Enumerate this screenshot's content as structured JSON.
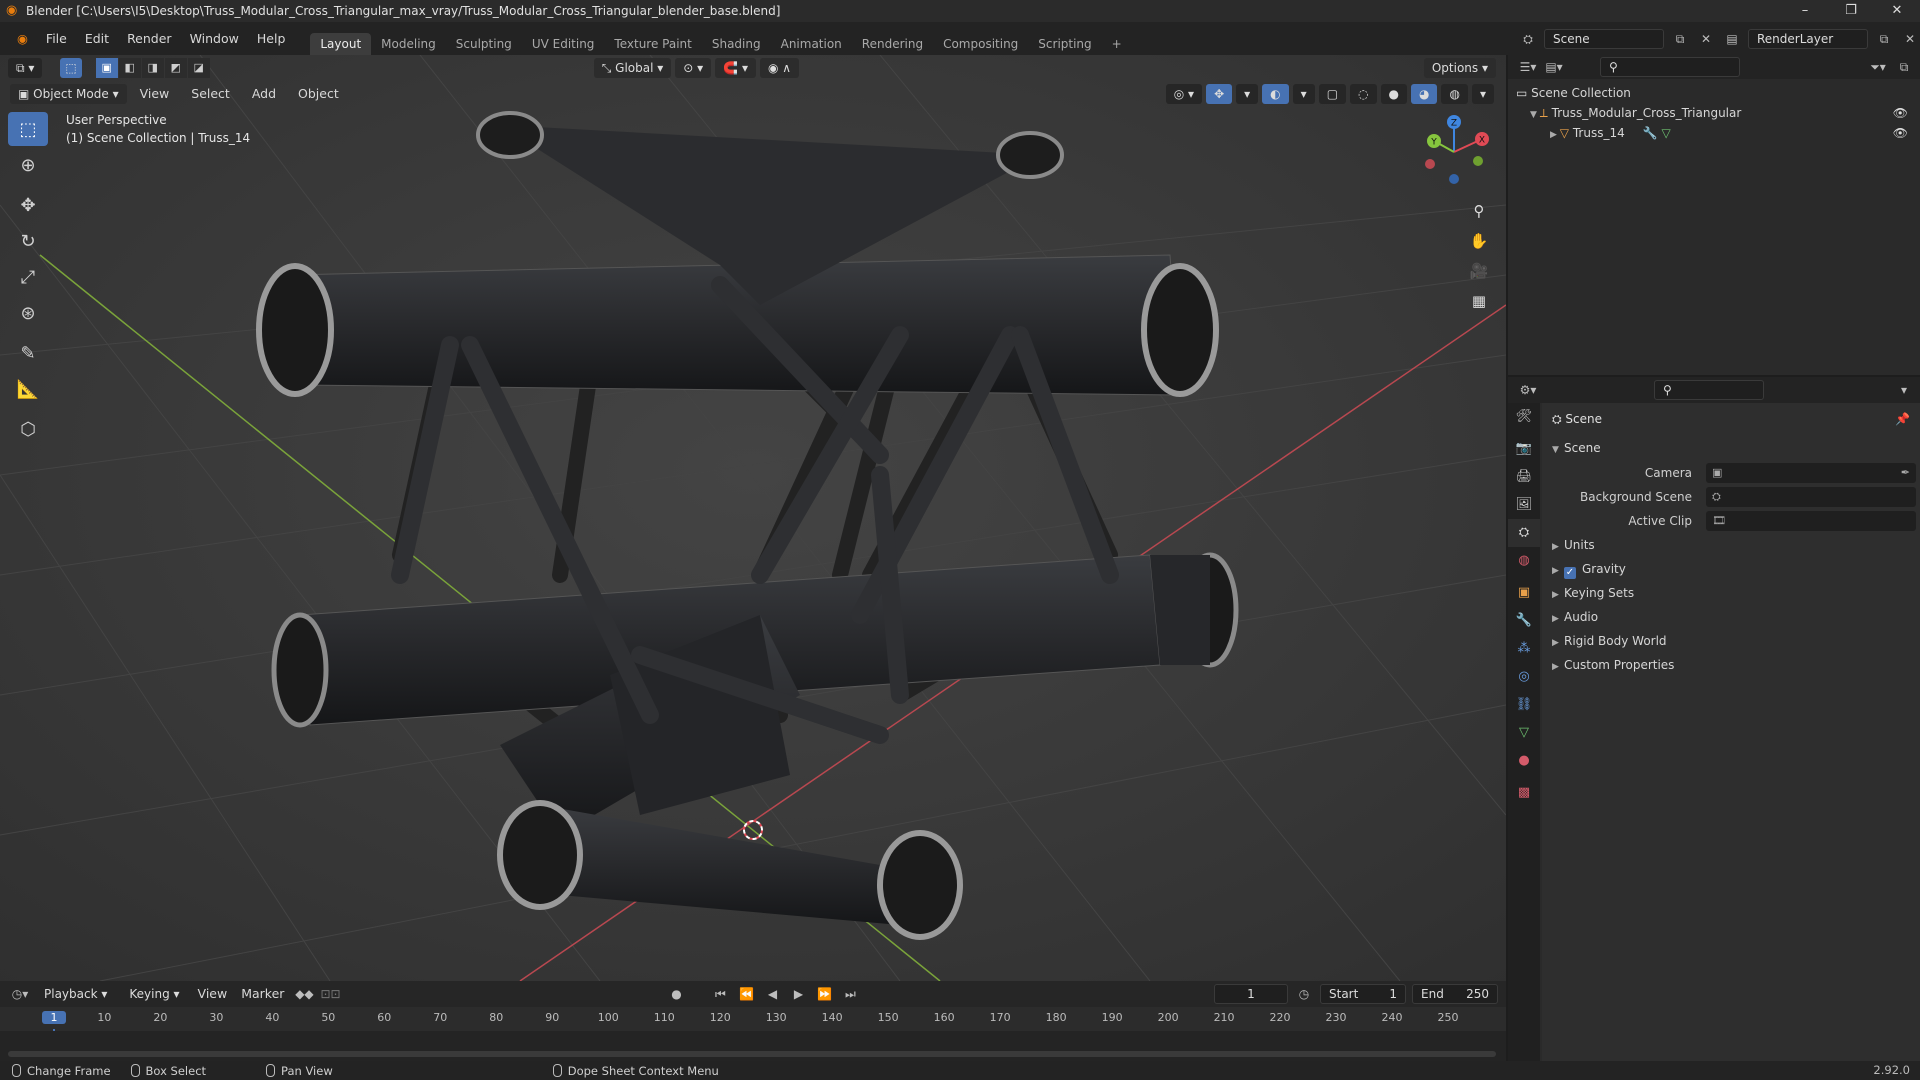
{
  "window": {
    "title": "Blender [C:\\Users\\I5\\Desktop\\Truss_Modular_Cross_Triangular_max_vray/Truss_Modular_Cross_Triangular_blender_base.blend]",
    "controls": [
      "–",
      "❐",
      "✕"
    ]
  },
  "menu": [
    "File",
    "Edit",
    "Render",
    "Window",
    "Help"
  ],
  "workspaces": [
    "Layout",
    "Modeling",
    "Sculpting",
    "UV Editing",
    "Texture Paint",
    "Shading",
    "Animation",
    "Rendering",
    "Compositing",
    "Scripting",
    "+"
  ],
  "active_workspace": "Layout",
  "scene_selector": {
    "scene": "Scene",
    "view_layer": "RenderLayer"
  },
  "viewport": {
    "mode": "Object Mode",
    "menus": [
      "View",
      "Select",
      "Add",
      "Object"
    ],
    "transform_orientation": "Global",
    "options_label": "Options",
    "overlay_line1": "User Perspective",
    "overlay_line2": "(1) Scene Collection | Truss_14",
    "gizmo_axes": {
      "x": "X",
      "y": "Y",
      "z": "Z"
    }
  },
  "tools": [
    "select-box",
    "cursor",
    "move",
    "rotate",
    "scale",
    "transform",
    "annotate",
    "measure",
    "add-cube"
  ],
  "outliner": {
    "root": "Scene Collection",
    "items": [
      {
        "label": "Truss_Modular_Cross_Triangular",
        "depth": 1
      },
      {
        "label": "Truss_14",
        "depth": 2
      }
    ]
  },
  "properties": {
    "context": "Scene",
    "panel": "Scene",
    "fields": [
      {
        "label": "Camera",
        "value": ""
      },
      {
        "label": "Background Scene",
        "value": ""
      },
      {
        "label": "Active Clip",
        "value": ""
      }
    ],
    "subpanels": [
      "Units",
      "Gravity",
      "Keying Sets",
      "Audio",
      "Rigid Body World",
      "Custom Properties"
    ],
    "gravity_checked": true
  },
  "timeline": {
    "menus": [
      "Playback",
      "Keying",
      "View",
      "Marker"
    ],
    "current_frame": "1",
    "start_label": "Start",
    "start": "1",
    "end_label": "End",
    "end": "250",
    "ticks": [
      "1",
      "10",
      "20",
      "30",
      "40",
      "50",
      "60",
      "70",
      "80",
      "90",
      "100",
      "110",
      "120",
      "130",
      "140",
      "150",
      "160",
      "170",
      "180",
      "190",
      "200",
      "210",
      "220",
      "230",
      "240",
      "250"
    ]
  },
  "status": {
    "items": [
      "Change Frame",
      "Box Select",
      "Pan View",
      "Dope Sheet Context Menu"
    ],
    "version": "2.92.0"
  },
  "colors": {
    "accent": "#4772b3",
    "x_axis": "#e04a55",
    "y_axis": "#86c53e",
    "z_axis": "#3f86e0",
    "brand": "#e87d0d"
  }
}
